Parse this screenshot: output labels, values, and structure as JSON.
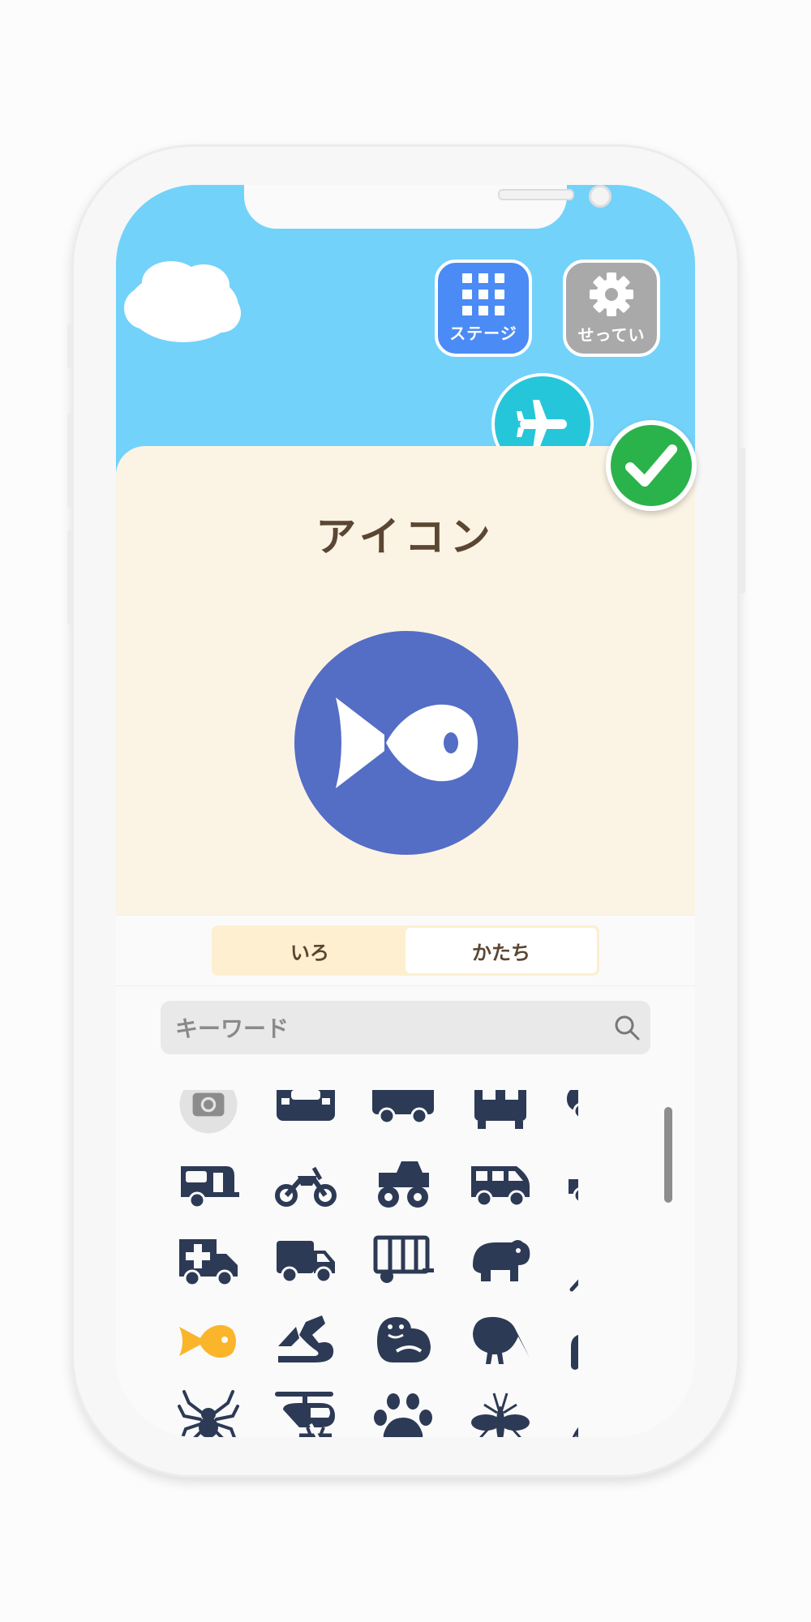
{
  "header": {
    "stage_label": "ステージ",
    "settings_label": "せってい"
  },
  "panel": {
    "title": "アイコン",
    "preview_icon": "fish-icon",
    "preview_color": "#546dc5"
  },
  "tabs": [
    {
      "label": "いろ",
      "selected": true
    },
    {
      "label": "かたち",
      "selected": false
    }
  ],
  "search": {
    "placeholder": "キーワード"
  },
  "icon_grid": [
    [
      "camera-icon",
      "bus-front-icon",
      "truck-icon",
      "train-front-icon",
      "car-side-icon"
    ],
    [
      "caravan-icon",
      "motorcycle-icon",
      "monster-truck-icon",
      "van-icon",
      "pickup-truck-icon"
    ],
    [
      "ambulance-icon",
      "delivery-truck-icon",
      "trailer-icon",
      "hippo-icon",
      "feather-icon"
    ],
    [
      "fish-icon",
      "dragon-icon",
      "otter-icon",
      "kiwi-bird-icon",
      "worm-icon"
    ],
    [
      "spider-icon",
      "helicopter-icon",
      "paw-icon",
      "mosquito-icon",
      "grasshopper-icon"
    ]
  ],
  "selected_icon": "fish-icon",
  "colors": {
    "sky": "#72d2fa",
    "panel": "#fbf4e4",
    "icon": "#2d3a55",
    "selected_icon": "#fbb52b",
    "confirm": "#2ab34a"
  }
}
